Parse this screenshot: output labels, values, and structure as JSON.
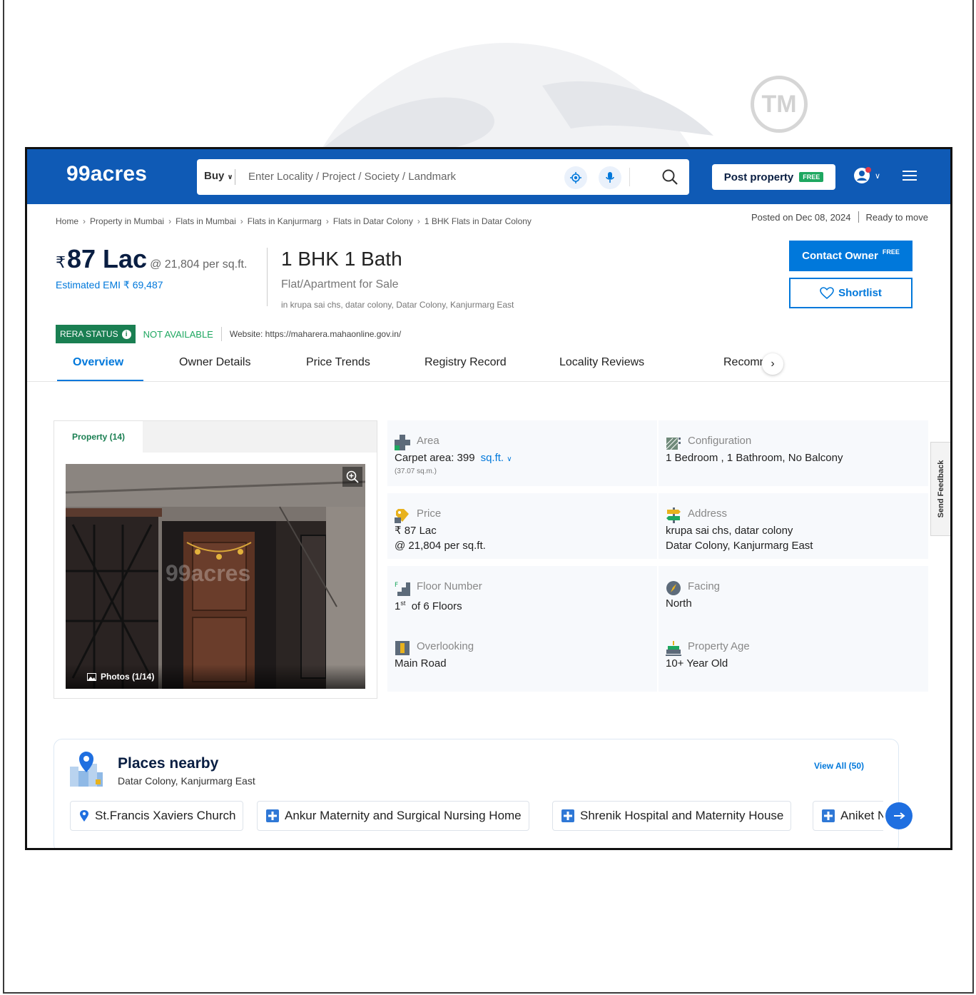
{
  "watermark": {
    "tm": "TM"
  },
  "header": {
    "logo": "99acres",
    "buy_label": "Buy",
    "search_placeholder": "Enter Locality / Project / Society / Landmark",
    "post_property_label": "Post property",
    "post_free_tag": "FREE"
  },
  "breadcrumb": [
    "Home",
    "Property in Mumbai",
    "Flats in Mumbai",
    "Flats in Kanjurmarg",
    "Flats in Datar Colony",
    "1 BHK Flats in Datar Colony"
  ],
  "posted": {
    "date": "Posted on Dec 08, 2024",
    "status": "Ready to move"
  },
  "listing": {
    "rupee": "₹",
    "price": "87 Lac",
    "price_per_sqft": "@ 21,804 per sq.ft.",
    "emi": "Estimated EMI ₹ 69,487",
    "title": "1 BHK 1 Bath",
    "subtitle": "Flat/Apartment for Sale",
    "address": "in krupa sai chs, datar colony, Datar Colony, Kanjurmarg East"
  },
  "actions": {
    "contact_label": "Contact Owner",
    "contact_free": "FREE",
    "shortlist_label": "Shortlist"
  },
  "rera": {
    "label": "RERA STATUS",
    "status": "NOT AVAILABLE",
    "website": "Website: https://maharera.mahaonline.gov.in/"
  },
  "tabs": [
    {
      "label": "Overview",
      "active": true
    },
    {
      "label": "Owner Details"
    },
    {
      "label": "Price Trends"
    },
    {
      "label": "Registry Record"
    },
    {
      "label": "Locality Reviews"
    },
    {
      "label": "Recommendations"
    }
  ],
  "gallery": {
    "tab_label": "Property (14)",
    "photo_count": "Photos (1/14)",
    "watermark": "99acres"
  },
  "details": {
    "area": {
      "label": "Area",
      "value": "Carpet area: 399",
      "unit": "sq.ft.",
      "sub": "(37.07 sq.m.)"
    },
    "configuration": {
      "label": "Configuration",
      "value": "1 Bedroom , 1 Bathroom, No Balcony"
    },
    "price": {
      "label": "Price",
      "value1": "₹ 87 Lac",
      "value2": "@ 21,804 per sq.ft."
    },
    "address": {
      "label": "Address",
      "value1": "krupa sai chs, datar colony",
      "value2": "Datar Colony, Kanjurmarg East"
    },
    "floor": {
      "label": "Floor Number",
      "floor_no": "1",
      "floor_sup": "st",
      "value": "of 6 Floors"
    },
    "facing": {
      "label": "Facing",
      "value": "North"
    },
    "overlooking": {
      "label": "Overlooking",
      "value": "Main Road"
    },
    "age": {
      "label": "Property Age",
      "value": "10+ Year Old"
    }
  },
  "feedback": {
    "label": "Send Feedback"
  },
  "places": {
    "title": "Places nearby",
    "subtitle": "Datar Colony, Kanjurmarg East",
    "view_all": "View All (50)",
    "items": [
      {
        "name": "St.Francis Xaviers Church",
        "icon": "location-pin-icon"
      },
      {
        "name": "Ankur Maternity and Surgical Nursing Home",
        "icon": "hospital-cross-icon"
      },
      {
        "name": "Shrenik Hospital and Maternity House",
        "icon": "hospital-cross-icon"
      },
      {
        "name": "Aniket Nursing Home",
        "icon": "hospital-cross-icon"
      }
    ]
  },
  "colors": {
    "brand_blue": "#0f5ab5",
    "link_blue": "#0078db",
    "rera_green": "#1a7f52",
    "free_green": "#1ea760"
  }
}
